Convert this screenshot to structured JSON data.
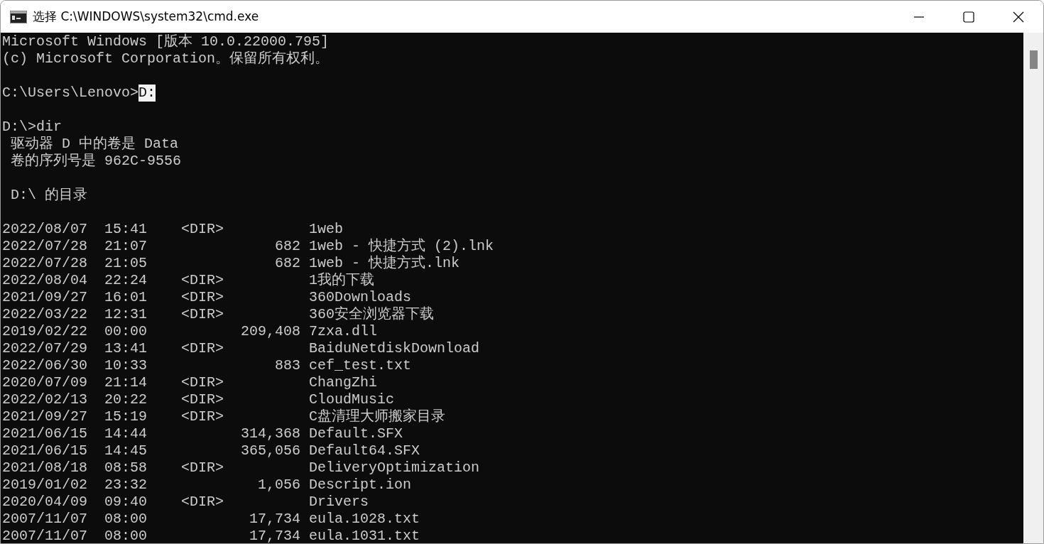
{
  "window": {
    "title": "选择 C:\\WINDOWS\\system32\\cmd.exe"
  },
  "console": {
    "header": [
      "Microsoft Windows [版本 10.0.22000.795]",
      "(c) Microsoft Corporation。保留所有权利。"
    ],
    "prompts": [
      {
        "prompt": "C:\\Users\\Lenovo>",
        "command": "D:",
        "selected": true
      },
      {
        "prompt": "D:\\>",
        "command": "dir",
        "selected": false,
        "output": [
          "驱动器 D 中的卷是 Data",
          "卷的序列号是 962C-9556"
        ]
      }
    ],
    "directory_heading": "D:\\ 的目录",
    "entries": [
      {
        "date": "2022/08/07",
        "time": "15:41",
        "type": "<DIR>",
        "name": "1web"
      },
      {
        "date": "2022/07/28",
        "time": "21:07",
        "size": "682",
        "name": "1web - 快捷方式 (2).lnk"
      },
      {
        "date": "2022/07/28",
        "time": "21:05",
        "size": "682",
        "name": "1web - 快捷方式.lnk"
      },
      {
        "date": "2022/08/04",
        "time": "22:24",
        "type": "<DIR>",
        "name": "1我的下载"
      },
      {
        "date": "2021/09/27",
        "time": "16:01",
        "type": "<DIR>",
        "name": "360Downloads"
      },
      {
        "date": "2022/03/22",
        "time": "12:31",
        "type": "<DIR>",
        "name": "360安全浏览器下载"
      },
      {
        "date": "2019/02/22",
        "time": "00:00",
        "size": "209,408",
        "name": "7zxa.dll"
      },
      {
        "date": "2022/07/29",
        "time": "13:41",
        "type": "<DIR>",
        "name": "BaiduNetdiskDownload"
      },
      {
        "date": "2022/06/30",
        "time": "10:33",
        "size": "883",
        "name": "cef_test.txt"
      },
      {
        "date": "2020/07/09",
        "time": "21:14",
        "type": "<DIR>",
        "name": "ChangZhi"
      },
      {
        "date": "2022/02/13",
        "time": "20:22",
        "type": "<DIR>",
        "name": "CloudMusic"
      },
      {
        "date": "2021/09/27",
        "time": "15:19",
        "type": "<DIR>",
        "name": "C盘清理大师搬家目录"
      },
      {
        "date": "2021/06/15",
        "time": "14:44",
        "size": "314,368",
        "name": "Default.SFX"
      },
      {
        "date": "2021/06/15",
        "time": "14:45",
        "size": "365,056",
        "name": "Default64.SFX"
      },
      {
        "date": "2021/08/18",
        "time": "08:58",
        "type": "<DIR>",
        "name": "DeliveryOptimization"
      },
      {
        "date": "2019/01/02",
        "time": "23:32",
        "size": "1,056",
        "name": "Descript.ion"
      },
      {
        "date": "2020/04/09",
        "time": "09:40",
        "type": "<DIR>",
        "name": "Drivers"
      },
      {
        "date": "2007/11/07",
        "time": "08:00",
        "size": "17,734",
        "name": "eula.1028.txt"
      },
      {
        "date": "2007/11/07",
        "time": "08:00",
        "size": "17,734",
        "name": "eula.1031.txt"
      }
    ]
  }
}
